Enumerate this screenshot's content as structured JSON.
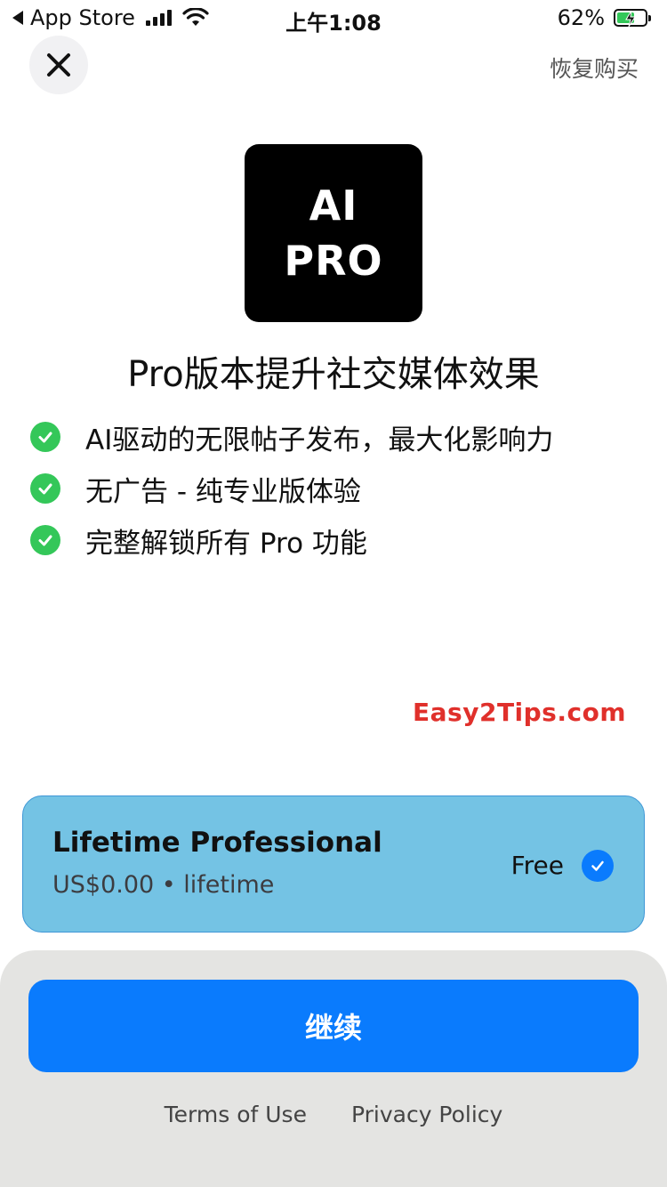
{
  "status_bar": {
    "back_app": "App Store",
    "time": "上午1:08",
    "battery_percent": "62%",
    "battery_level": 0.62
  },
  "header": {
    "restore_label": "恢复购买"
  },
  "logo": {
    "line1": "AI",
    "line2": "PRO"
  },
  "title": "Pro版本提升社交媒体效果",
  "features": [
    "AI驱动的无限帖子发布，最大化影响力",
    "无广告 - 纯专业版体验",
    "完整解锁所有 Pro 功能"
  ],
  "watermark": "Easy2Tips.com",
  "plan": {
    "name": "Lifetime Professional",
    "price": "US$0.00 • lifetime",
    "badge": "Free",
    "selected": true
  },
  "actions": {
    "continue_label": "继续",
    "terms_label": "Terms of Use",
    "privacy_label": "Privacy Policy"
  },
  "colors": {
    "accent": "#0a7bfd",
    "check": "#34c759",
    "card_bg": "#74c3e4",
    "watermark": "#e0302b"
  }
}
